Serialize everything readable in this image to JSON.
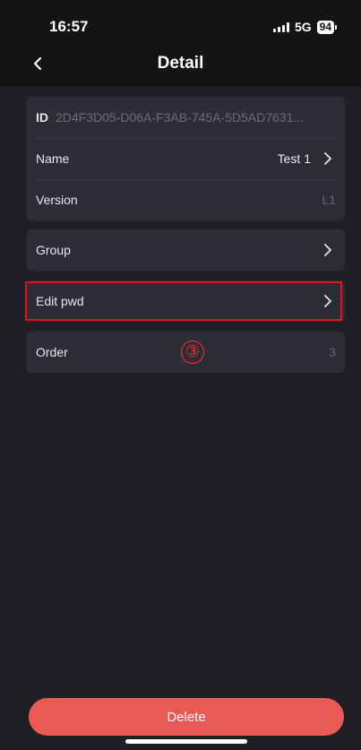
{
  "status_bar": {
    "time": "16:57",
    "network": "5G",
    "battery": "94"
  },
  "nav": {
    "title": "Detail",
    "back_icon": "chevron-left-icon"
  },
  "info_card": {
    "id_label": "ID",
    "id_value": "2D4F3D05-D06A-F3AB-745A-5D5AD7631...",
    "name_label": "Name",
    "name_value": "Test 1",
    "version_label": "Version",
    "version_value": "L1"
  },
  "group": {
    "label": "Group"
  },
  "edit_pwd": {
    "label": "Edit pwd"
  },
  "order": {
    "label": "Order",
    "value": "3"
  },
  "annotation": {
    "step_marker": "③",
    "highlight_color": "#e0141b"
  },
  "actions": {
    "delete_label": "Delete",
    "delete_color": "#ea5a55"
  }
}
